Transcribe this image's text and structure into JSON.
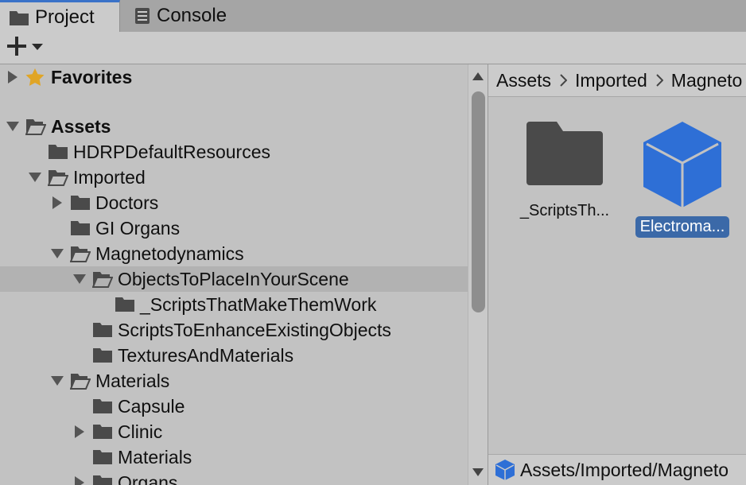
{
  "tabs": {
    "project": "Project",
    "console": "Console"
  },
  "toolbar": {
    "create_icon": "plus-icon"
  },
  "tree": {
    "favorites": "Favorites",
    "assets": "Assets",
    "items": [
      {
        "label": "HDRPDefaultResources"
      },
      {
        "label": "Imported"
      },
      {
        "label": "Doctors"
      },
      {
        "label": "GI Organs"
      },
      {
        "label": "Magnetodynamics"
      },
      {
        "label": "ObjectsToPlaceInYourScene"
      },
      {
        "label": "_ScriptsThatMakeThemWork"
      },
      {
        "label": "ScriptsToEnhanceExistingObjects"
      },
      {
        "label": "TexturesAndMaterials"
      },
      {
        "label": "Materials"
      },
      {
        "label": "Capsule"
      },
      {
        "label": "Clinic"
      },
      {
        "label": "Materials"
      },
      {
        "label": "Organs"
      }
    ]
  },
  "breadcrumb": {
    "items": [
      "Assets",
      "Imported",
      "Magneto"
    ]
  },
  "grid": {
    "items": [
      {
        "label": "_ScriptsTh...",
        "icon": "folder-icon"
      },
      {
        "label": "Electroma...",
        "icon": "prefab-cube-icon"
      }
    ]
  },
  "status": {
    "path": "Assets/Imported/Magneto"
  },
  "colors": {
    "accent": "#3a72c8",
    "selection": "#3b69a8",
    "prefab": "#2e6fd6",
    "folder": "#4a4a4a",
    "star": "#e0a526"
  }
}
